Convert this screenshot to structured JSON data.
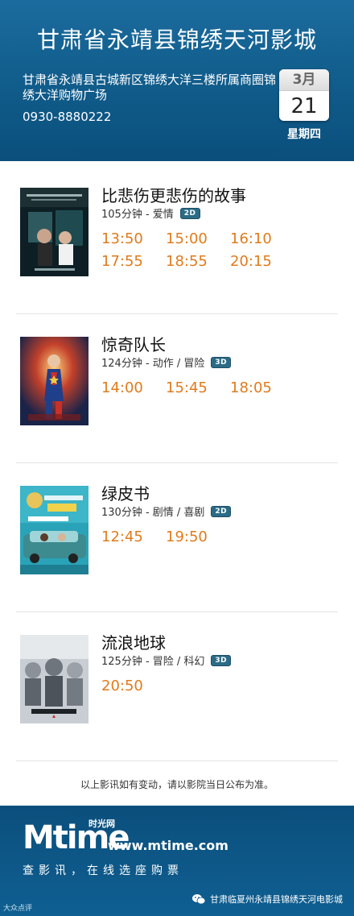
{
  "header": {
    "cinema_name": "甘肃省永靖县锦绣天河影城",
    "address": "甘肃省永靖县古城新区锦绣大洋三楼所属商圈锦绣大洋购物广场",
    "phone": "0930-8880222",
    "calendar_month": "3月",
    "calendar_day": "21",
    "weekday": "星期四"
  },
  "movies": [
    {
      "title": "比悲伤更悲伤的故事",
      "info": "105分钟 - 爱情",
      "format": "2D",
      "poster_icon": "movie-poster",
      "times": [
        "13:50",
        "15:00",
        "16:10",
        "17:55",
        "18:55",
        "20:15"
      ]
    },
    {
      "title": "惊奇队长",
      "info": "124分钟 - 动作 / 冒险",
      "format": "3D",
      "poster_icon": "movie-poster",
      "times": [
        "14:00",
        "15:45",
        "18:05"
      ]
    },
    {
      "title": "绿皮书",
      "info": "130分钟 - 剧情 / 喜剧",
      "format": "2D",
      "poster_icon": "movie-poster",
      "times": [
        "12:45",
        "19:50"
      ]
    },
    {
      "title": "流浪地球",
      "info": "125分钟 - 冒险 / 科幻",
      "format": "3D",
      "poster_icon": "movie-poster",
      "times": [
        "20:50"
      ]
    }
  ],
  "notice": "以上影讯如有变动，请以影院当日公布为准。",
  "footer": {
    "logo_text": "Mtime",
    "logo_cn": "时光网",
    "url": "www.mtime.com",
    "slogan": "查影讯，在线选座购票",
    "wechat_account": "甘肃临夏州永靖县锦绣天河电影城",
    "watermark": "大众点评"
  },
  "colors": {
    "header_blue": "#0f5a88",
    "time_orange": "#e07b1c",
    "badge": "#2b6b86"
  }
}
